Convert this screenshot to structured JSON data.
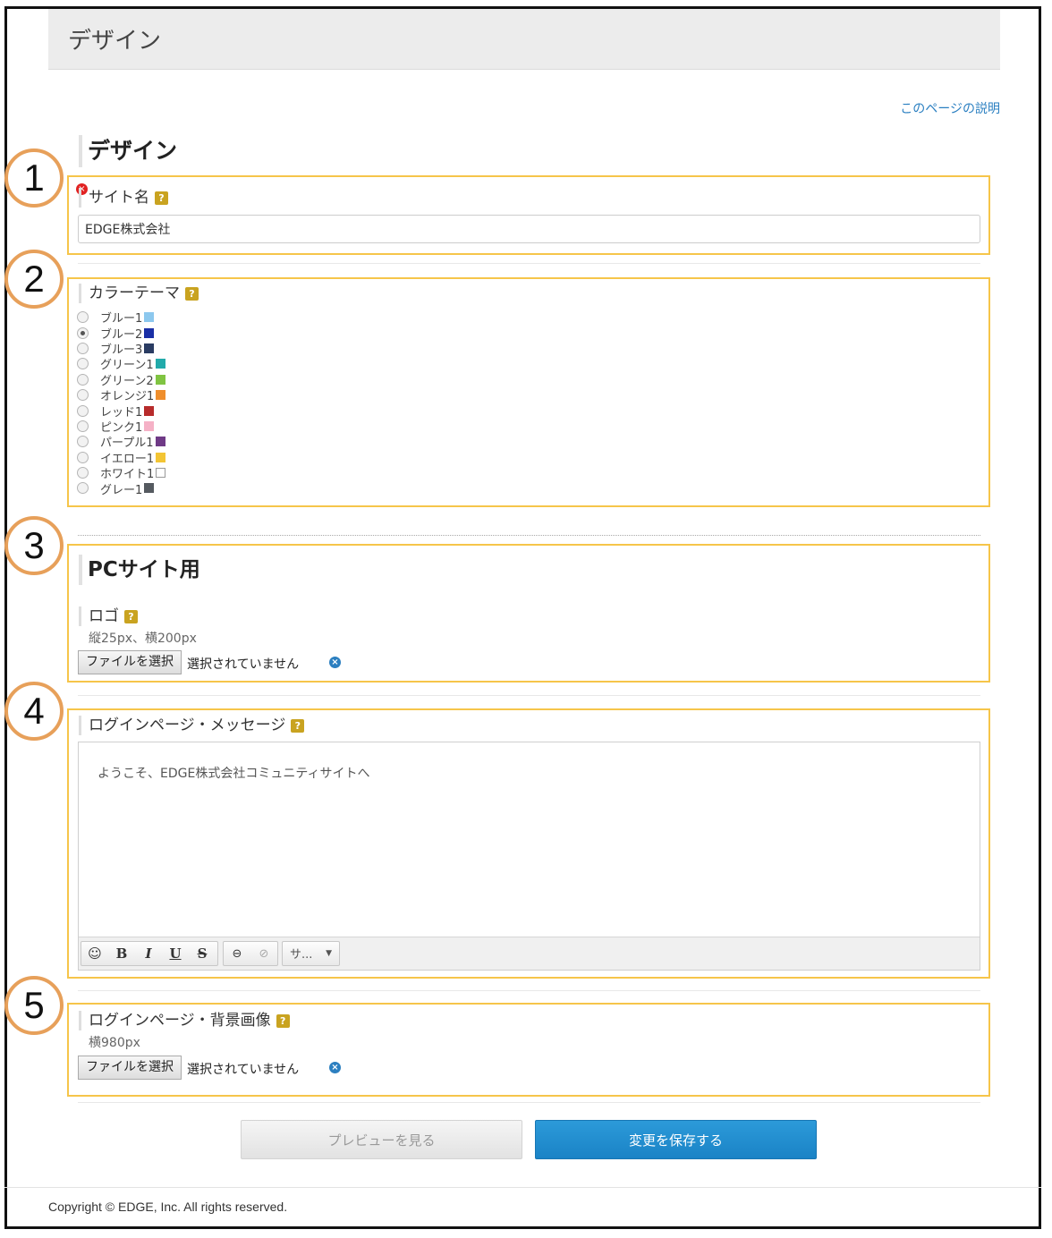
{
  "header": {
    "title": "デザイン"
  },
  "help_link": "このページの説明",
  "section_title": "デザイン",
  "annotations": [
    "1",
    "2",
    "3",
    "4",
    "5"
  ],
  "site_name": {
    "label": "サイト名",
    "value": "EDGE株式会社",
    "required_icon": "required-x-icon",
    "help_icon": "?"
  },
  "color_theme": {
    "label": "カラーテーマ",
    "help_icon": "?",
    "selected": "ブルー2",
    "options": [
      {
        "label": "ブルー1",
        "color": "#8cc8ee",
        "checked": false
      },
      {
        "label": "ブルー2",
        "color": "#1a2fa6",
        "checked": true
      },
      {
        "label": "ブルー3",
        "color": "#2a3c62",
        "checked": false
      },
      {
        "label": "グリーン1",
        "color": "#22aaaa",
        "checked": false
      },
      {
        "label": "グリーン2",
        "color": "#80c442",
        "checked": false
      },
      {
        "label": "オレンジ1",
        "color": "#ef8e2c",
        "checked": false
      },
      {
        "label": "レッド1",
        "color": "#b72b2b",
        "checked": false
      },
      {
        "label": "ピンク1",
        "color": "#f5b1c6",
        "checked": false
      },
      {
        "label": "パープル1",
        "color": "#6f3a86",
        "checked": false
      },
      {
        "label": "イエロー1",
        "color": "#f3c534",
        "checked": false
      },
      {
        "label": "ホワイト1",
        "color": "#ffffff",
        "checked": false
      },
      {
        "label": "グレー1",
        "color": "#555a60",
        "checked": false
      }
    ]
  },
  "pc_site": {
    "title": "PCサイト用",
    "logo": {
      "label": "ロゴ",
      "help_icon": "?",
      "hint": "縦25px、横200px",
      "file_button": "ファイルを選択",
      "file_status": "選択されていません"
    }
  },
  "login_message": {
    "label": "ログインページ・メッセージ",
    "help_icon": "?",
    "content": "ようこそ、EDGE株式会社コミュニティサイトへ",
    "toolbar": {
      "font_select": "サ..."
    }
  },
  "login_background": {
    "label": "ログインページ・背景画像",
    "help_icon": "?",
    "hint": "横980px",
    "file_button": "ファイルを選択",
    "file_status": "選択されていません"
  },
  "buttons": {
    "preview": "プレビューを見る",
    "save": "変更を保存する"
  },
  "footer": "Copyright © EDGE, Inc. All rights reserved."
}
